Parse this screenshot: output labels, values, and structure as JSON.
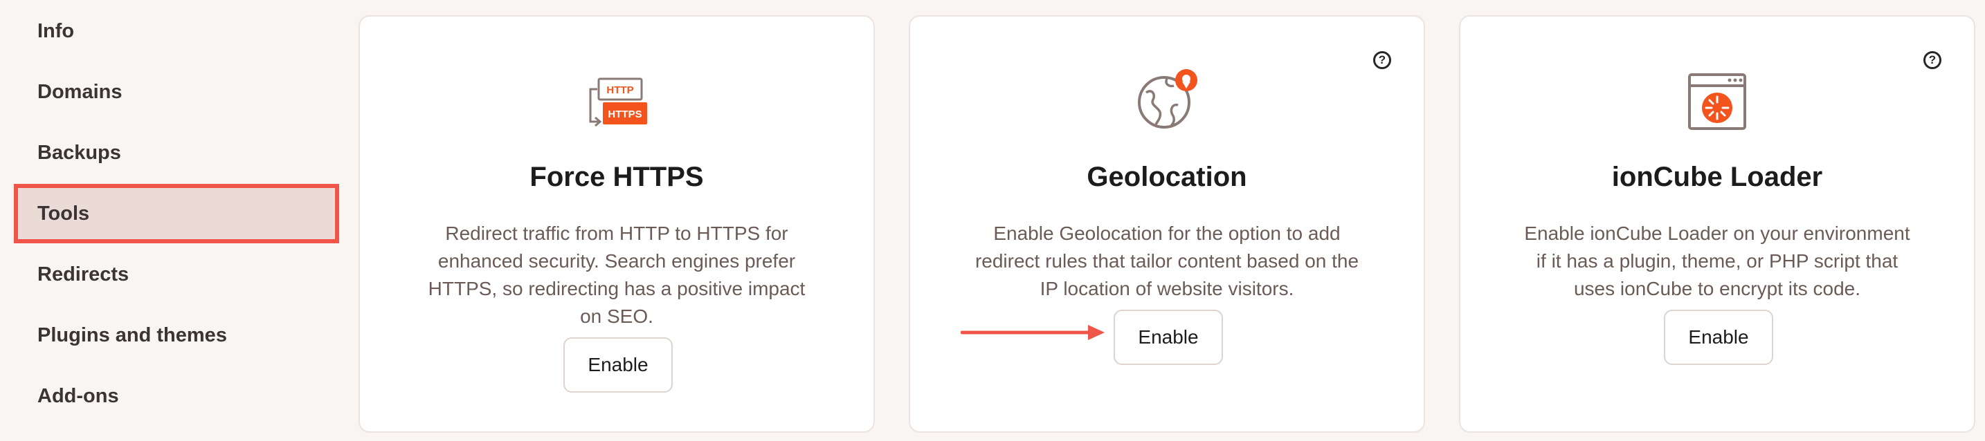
{
  "sidebar": {
    "items": [
      {
        "label": "Info"
      },
      {
        "label": "Domains"
      },
      {
        "label": "Backups"
      },
      {
        "label": "Tools",
        "active": true
      },
      {
        "label": "Redirects"
      },
      {
        "label": "Plugins and themes"
      },
      {
        "label": "Add-ons"
      }
    ]
  },
  "cards": [
    {
      "icon": "http-to-https-icon",
      "icon_text_top": "HTTP",
      "icon_text_bottom": "HTTPS",
      "title": "Force HTTPS",
      "description_lines": [
        "Redirect traffic from HTTP to HTTPS for",
        "enhanced security. Search engines prefer",
        "HTTPS, so redirecting has a positive impact",
        "on SEO."
      ],
      "button": "Enable"
    },
    {
      "icon": "globe-location-icon",
      "title": "Geolocation",
      "description_lines": [
        "Enable Geolocation for the option to add",
        "redirect rules that tailor content based on the",
        "IP location of website visitors."
      ],
      "button": "Enable",
      "help_icon": "help-icon"
    },
    {
      "icon": "browser-loader-icon",
      "title": "ionCube Loader",
      "description_lines": [
        "Enable ionCube Loader on your environment",
        "if it has a plugin, theme, or PHP script that",
        "uses ionCube to encrypt its code."
      ],
      "button": "Enable",
      "help_icon": "help-icon"
    }
  ],
  "annotation": {
    "arrow_icon": "red-arrow-icon"
  },
  "colors": {
    "accent": "#f0554a",
    "icon_orange": "#f3531c",
    "icon_brown": "#8a7a76",
    "help_glyph": "?"
  }
}
